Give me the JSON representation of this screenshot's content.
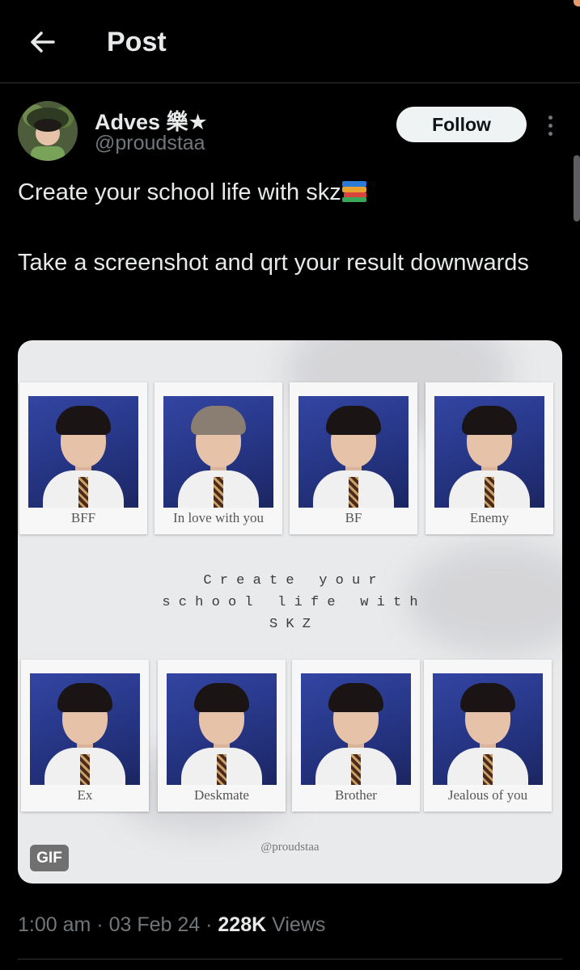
{
  "header": {
    "title": "Post",
    "back_icon": "arrow-left-icon"
  },
  "author": {
    "name": "Adves 樂★",
    "handle": "@proudstaa",
    "follow_label": "Follow",
    "more_icon": "more-vertical-icon"
  },
  "tweet": {
    "line1": "Create your school life with skz",
    "line1_emoji": "books-emoji",
    "line2": "Take a screenshot and qrt your result downwards"
  },
  "media": {
    "badge": "GIF",
    "top_row": [
      "BFF",
      "In love with you",
      "BF",
      "Enemy"
    ],
    "bottom_row": [
      "Ex",
      "Deskmate",
      "Brother",
      "Jealous of you"
    ],
    "center_lines": [
      "C r e a t e   y o u r",
      "s c h o o l   l i f e   w i t h",
      "S K Z"
    ],
    "watermark": "@proudstaa"
  },
  "meta": {
    "time": "1:00 am",
    "date": "03 Feb 24",
    "views_count": "228K",
    "views_label": "Views",
    "separator": "·"
  },
  "colors": {
    "background": "#000000",
    "text": "#e7e9ea",
    "muted": "#71767b",
    "follow_bg": "#eff3f4"
  }
}
